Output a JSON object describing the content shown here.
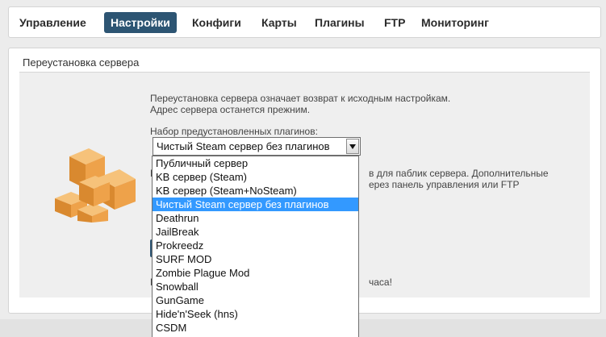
{
  "nav": {
    "items": [
      {
        "label": "Управление"
      },
      {
        "label": "Настройки",
        "active": true
      },
      {
        "label": "Конфиги"
      },
      {
        "label": "Карты"
      },
      {
        "label": "Плагины"
      },
      {
        "label": "FTP"
      },
      {
        "label": "Мониторинг"
      }
    ]
  },
  "panel": {
    "title": "Переустановка сервера",
    "description_line1": "Переустановка сервера означает возврат к исходным настройкам.",
    "description_line2": "Адрес сервера останется прежним.",
    "preset_label": "Набор предустановленных плагинов:",
    "hint_line1": "в для паблик сервера. Дополнительные",
    "hint_line2": "ерез панель управления или FTP",
    "hint_left_char": "E",
    "warn_left_char": "П",
    "warning": "часа!"
  },
  "select": {
    "value": "Чистый Steam сервер без плагинов",
    "options": [
      "Публичный сервер",
      "KB сервер (Steam)",
      "KB сервер (Steam+NoSteam)",
      "Чистый Steam сервер без плагинов",
      "Deathrun",
      "JailBreak",
      "Prokreedz",
      "SURF MOD",
      "Zombie Plague Mod",
      "Snowball",
      "GunGame",
      "Hide'n'Seek (hns)",
      "CSDM"
    ],
    "selected_index": 3
  },
  "colors": {
    "nav_active_bg": "#2d5573",
    "selection_bg": "#3399ff",
    "box_fill": "#e8a24a"
  }
}
